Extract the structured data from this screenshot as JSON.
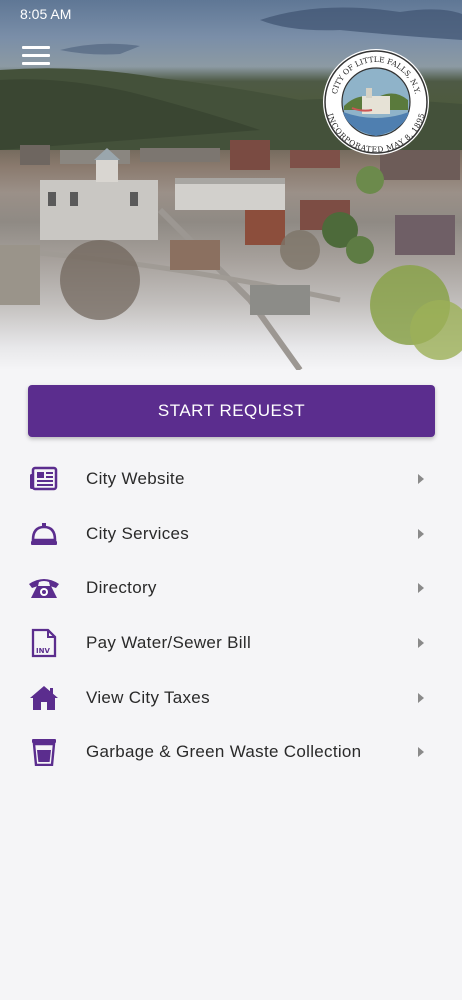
{
  "status_bar": {
    "time": "8:05 AM"
  },
  "header": {
    "menu_icon": "hamburger-menu-icon",
    "seal": {
      "top_text": "CITY OF LITTLE FALLS, N.Y.",
      "bottom_text": "INCORPORATED MAY 8, 1895"
    }
  },
  "main": {
    "start_request_label": "START REQUEST",
    "accent_color": "#5b2d8e",
    "items": [
      {
        "label": "City Website",
        "icon": "newspaper-icon"
      },
      {
        "label": "City Services",
        "icon": "service-bell-icon"
      },
      {
        "label": "Directory",
        "icon": "telephone-icon"
      },
      {
        "label": "Pay Water/Sewer Bill",
        "icon": "invoice-icon",
        "icon_text": "INV"
      },
      {
        "label": "View City Taxes",
        "icon": "home-icon"
      },
      {
        "label": "Garbage & Green Waste Collection",
        "icon": "trash-cup-icon"
      }
    ]
  }
}
